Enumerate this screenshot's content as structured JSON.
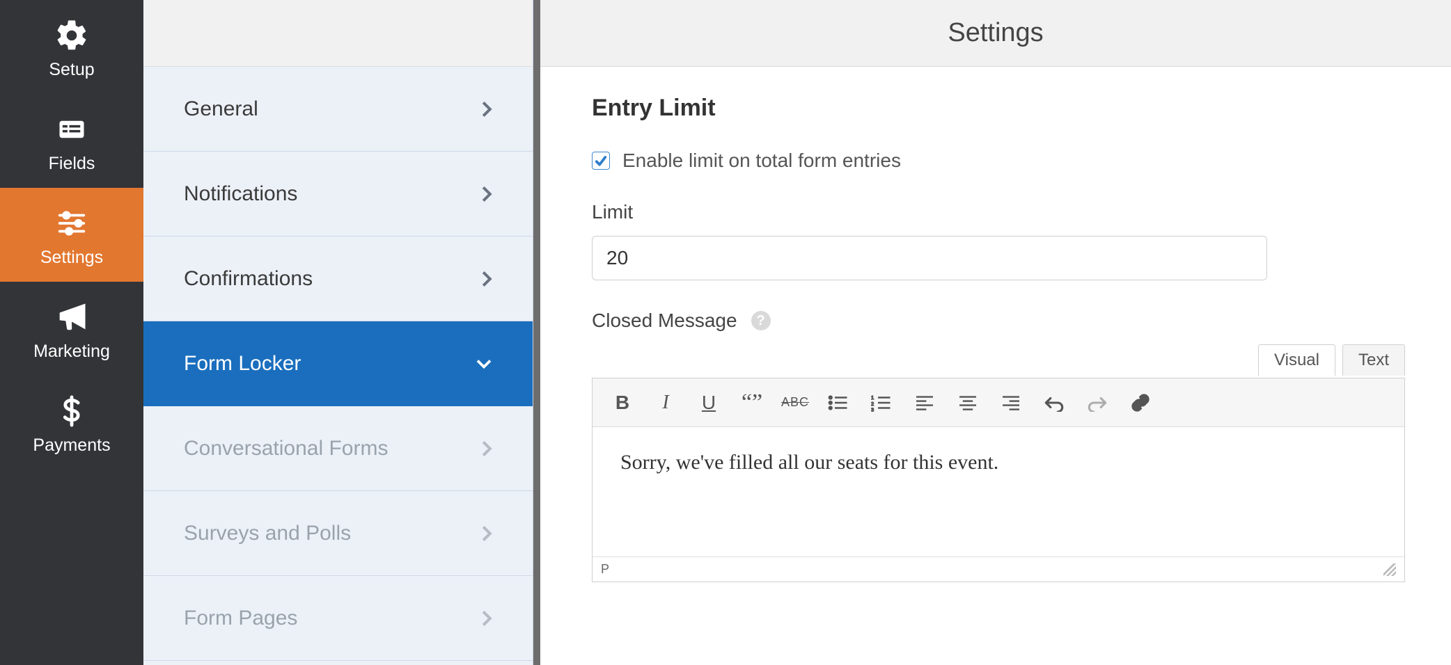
{
  "header": {
    "title": "Settings"
  },
  "primary_nav": {
    "items": [
      {
        "label": "Setup"
      },
      {
        "label": "Fields"
      },
      {
        "label": "Settings"
      },
      {
        "label": "Marketing"
      },
      {
        "label": "Payments"
      }
    ],
    "active_index": 2
  },
  "settings_menu": {
    "items": [
      {
        "label": "General"
      },
      {
        "label": "Notifications"
      },
      {
        "label": "Confirmations"
      },
      {
        "label": "Form Locker"
      },
      {
        "label": "Conversational Forms"
      },
      {
        "label": "Surveys and Polls"
      },
      {
        "label": "Form Pages"
      }
    ],
    "active_index": 3
  },
  "entry_limit": {
    "section_title": "Entry Limit",
    "enable_checked": true,
    "enable_label": "Enable limit on total form entries",
    "limit_label": "Limit",
    "limit_value": "20",
    "closed_message_label": "Closed Message",
    "closed_message_body": "Sorry, we've filled all our seats for this event."
  },
  "editor": {
    "tabs": {
      "visual": "Visual",
      "text": "Text",
      "active": "visual"
    },
    "status_path": "P",
    "toolbar": {
      "bold": "B",
      "italic": "I",
      "underline": "U",
      "quote": "“”",
      "strike": "ABC"
    }
  },
  "annotation": {
    "color": "#ff0007",
    "type": "arrow-pointing-left"
  }
}
